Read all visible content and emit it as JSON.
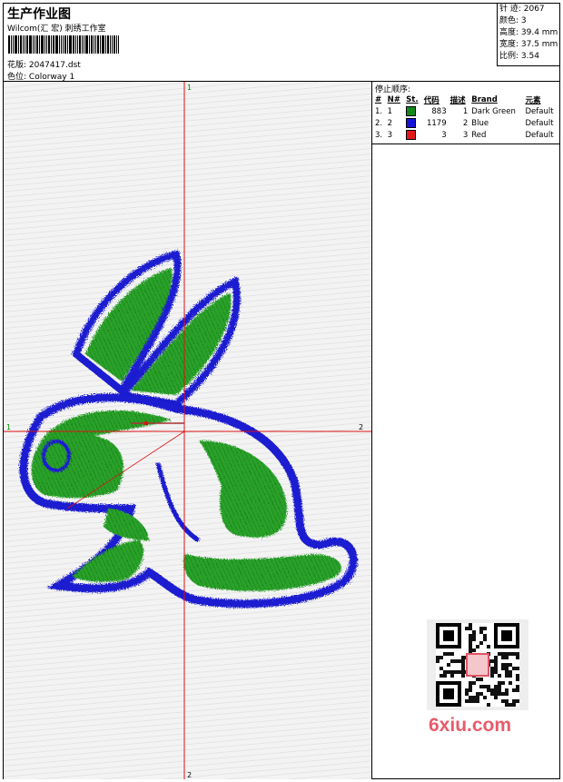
{
  "header": {
    "title": "生产作业图",
    "company": "Wilcom(汇 宏) 刺绣工作室",
    "file_label": "花版:",
    "file_name": "2047417.dst",
    "colorway_label": "色位:",
    "colorway": "Colorway 1"
  },
  "stats": {
    "stitches": "针 迹: 2067",
    "colors": "颜色: 3",
    "height": "高度: 39.4 mm",
    "width": "宽度: 37.5 mm",
    "ratio": "比例: 3.54"
  },
  "stop_sequence": {
    "title": "停止顺序:",
    "headers": [
      "#",
      "N#",
      "St.",
      "代码",
      "描述",
      "Brand",
      "元素"
    ],
    "rows": [
      {
        "idx": "1.",
        "n": "1",
        "color": "#118a1a",
        "st": "883",
        "code": "1",
        "desc": "Dark Green",
        "brand": "Default"
      },
      {
        "idx": "2.",
        "n": "2",
        "color": "#1414d8",
        "st": "1179",
        "code": "2",
        "desc": "Blue",
        "brand": "Default"
      },
      {
        "idx": "3.",
        "n": "3",
        "color": "#e21818",
        "st": "3",
        "code": "3",
        "desc": "Red",
        "brand": "Default"
      }
    ]
  },
  "axes": {
    "top": "1",
    "bottom": "2",
    "left": "1",
    "right": "2"
  },
  "watermark": {
    "site": "6xiu.com"
  },
  "colors": {
    "green": "#1e9a1e",
    "blue": "#1a1ad0",
    "red": "#dd1111"
  }
}
